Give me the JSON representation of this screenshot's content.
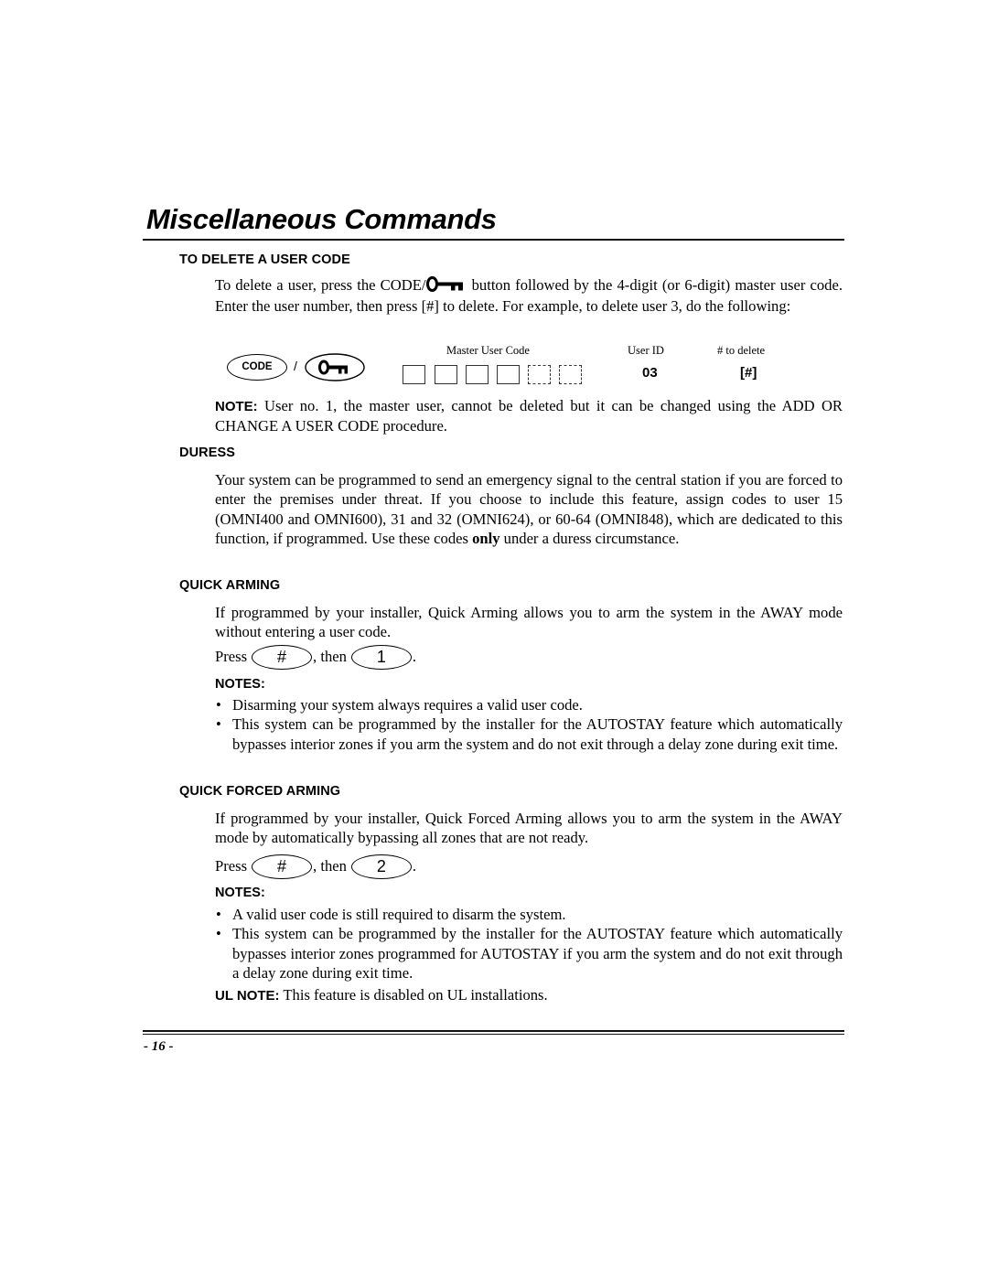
{
  "page": {
    "title": "Miscellaneous Commands",
    "page_number": "- 16 -"
  },
  "delete_user_code": {
    "heading": "TO DELETE A USER CODE",
    "para_part1": "To delete a user, press the CODE/",
    "para_part2": " button followed by the 4-digit (or 6-digit) master user code.  Enter the user number, then press [#] to delete.  For example, to delete user 3, do the following:",
    "diagram": {
      "code_button_label": "CODE",
      "separator": "/",
      "key_button_icon": "key-icon",
      "master_code_label": "Master User Code",
      "required_digits": 4,
      "optional_digits": 2,
      "user_id_label": "User ID",
      "user_id_value": "03",
      "delete_label": "# to delete",
      "delete_value": "[#]"
    },
    "note_label": "NOTE:",
    "note_text": "  User no. 1, the master user, cannot be deleted but it can be changed using the ADD OR CHANGE A USER CODE procedure."
  },
  "duress": {
    "heading": "DURESS",
    "para_part1": "Your system can be programmed to send an emergency signal to the central station if you are forced to enter the premises under threat.  If you choose to include this feature, assign codes to user 15 (OMNI400 and OMNI600), 31 and 32 (OMNI624), or 60-64 (OMNI848), which are dedicated to this function, if programmed.  Use these codes ",
    "para_bold": "only",
    "para_part2": " under a duress circumstance."
  },
  "quick_arming": {
    "heading": "QUICK ARMING",
    "para": "If programmed by your installer, Quick Arming allows you to arm the system in the AWAY mode without entering a user code.",
    "press_label": "Press",
    "key1": "#",
    "then_label": ", then",
    "key2": "1",
    "end": ".",
    "notes_heading": "NOTES:",
    "notes": [
      "Disarming your system always requires a valid user code.",
      "This system can be programmed by the installer for the AUTOSTAY feature which automatically bypasses interior zones if you arm the system and do not exit through a delay zone during exit time."
    ]
  },
  "quick_forced_arming": {
    "heading": "QUICK FORCED ARMING",
    "para": "If programmed by your installer, Quick Forced Arming allows you to arm the system in the AWAY mode by automatically bypassing all zones that are not ready.",
    "press_label": "Press",
    "key1": "#",
    "then_label": ", then",
    "key2": "2",
    "end": ".",
    "notes_heading": "NOTES:",
    "notes": [
      "A valid user code is still required to disarm the system.",
      "This system can be programmed by the installer for the AUTOSTAY feature which automatically bypasses interior zones programmed for AUTOSTAY if you arm the system and do not exit through a delay zone during exit time."
    ],
    "ul_note_label": "UL NOTE:",
    "ul_note_text": "  This feature is disabled on UL installations."
  }
}
